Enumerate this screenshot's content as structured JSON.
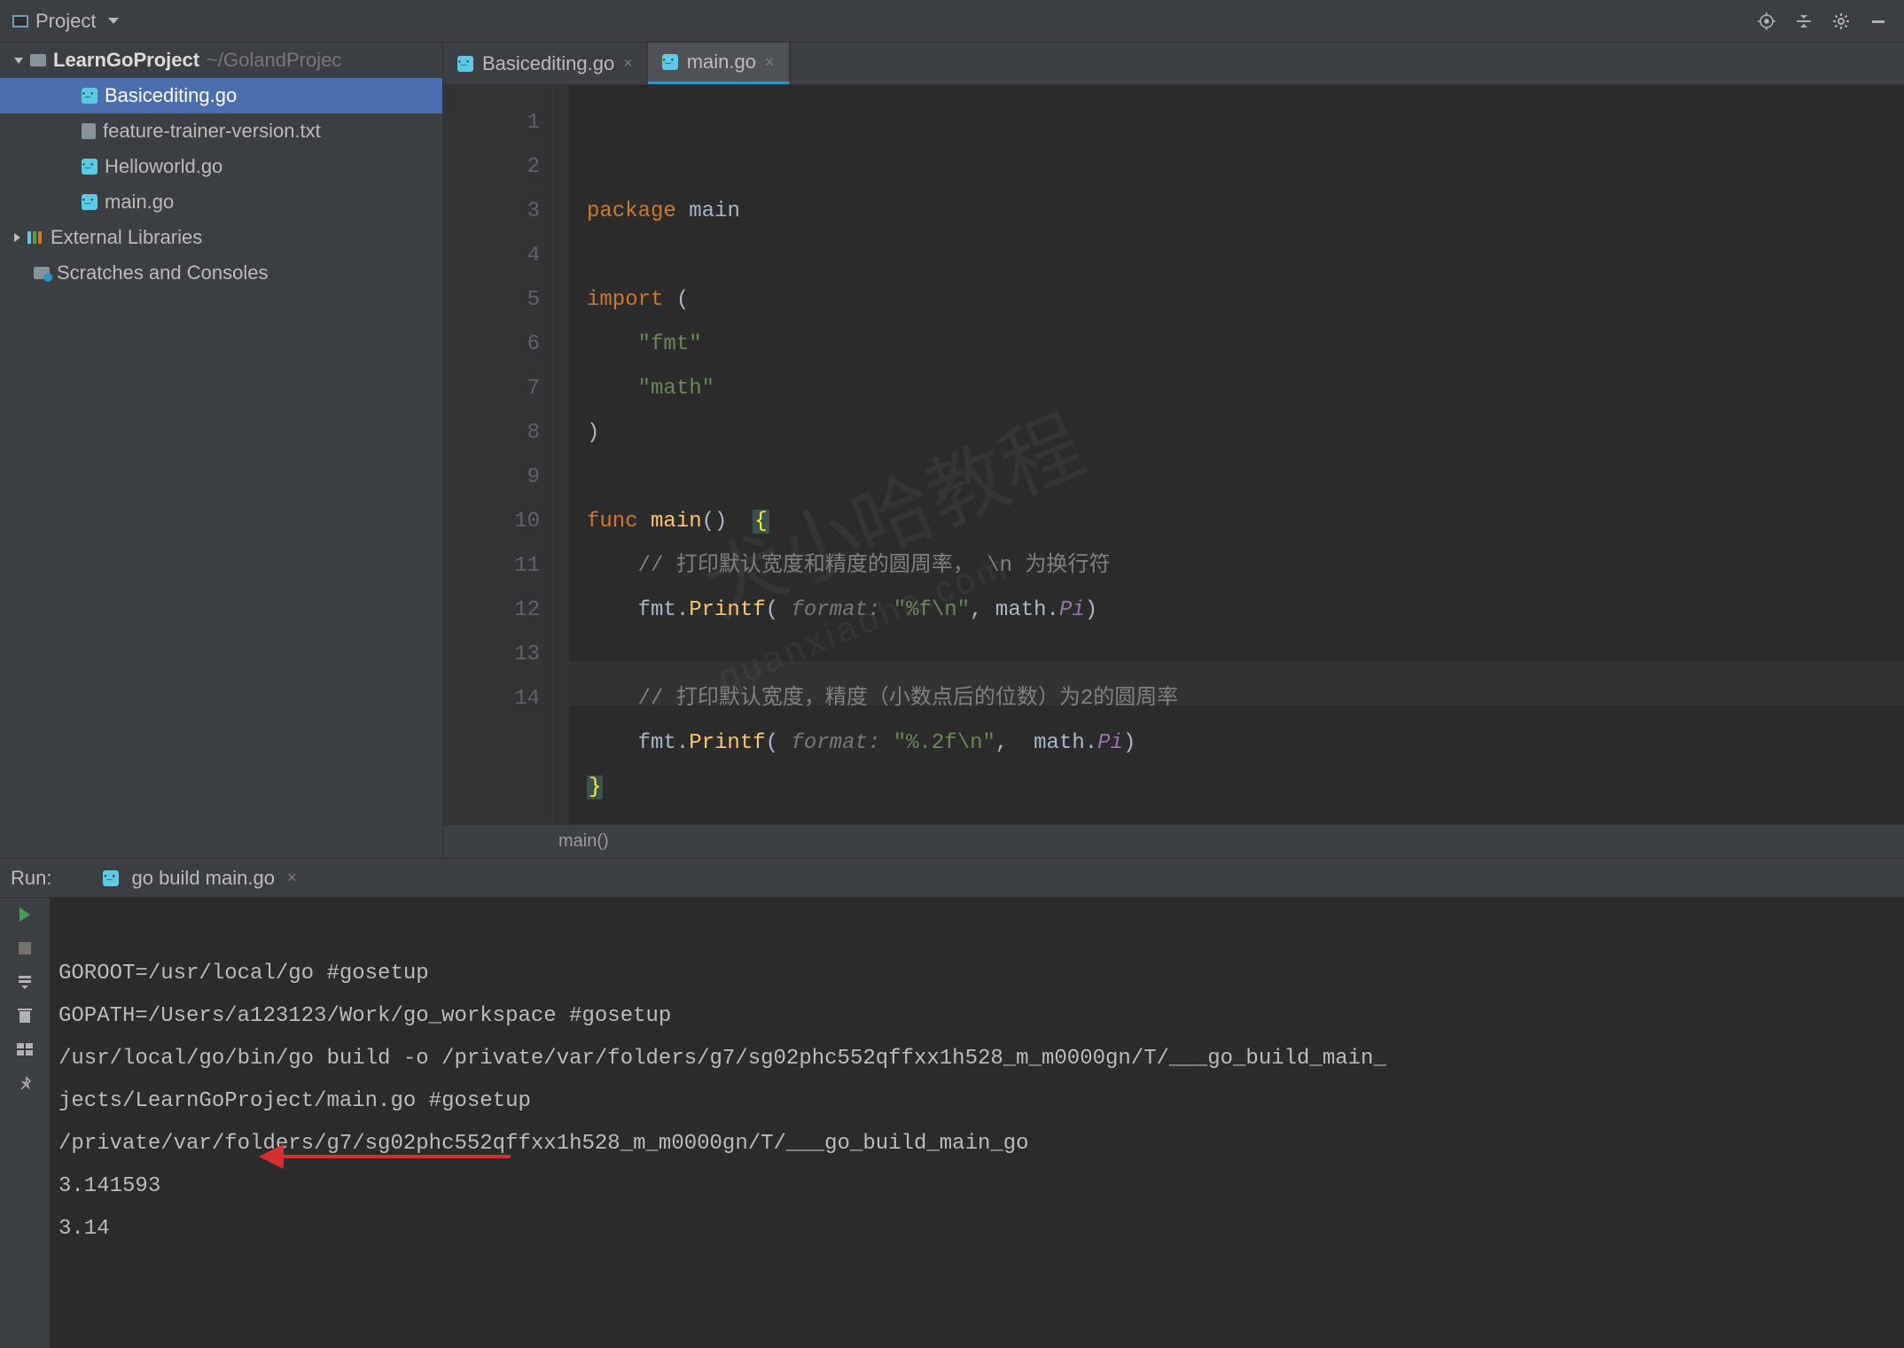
{
  "top": {
    "project_label": "Project"
  },
  "tree": {
    "root_name": "LearnGoProject",
    "root_path": "~/GolandProjec",
    "files": [
      "Basicediting.go",
      "feature-trainer-version.txt",
      "Helloworld.go",
      "main.go"
    ],
    "external": "External Libraries",
    "scratches": "Scratches and Consoles"
  },
  "tabs": [
    {
      "label": "Basicediting.go",
      "active": false
    },
    {
      "label": "main.go",
      "active": true
    }
  ],
  "editor": {
    "lines": [
      "1",
      "2",
      "3",
      "4",
      "5",
      "6",
      "7",
      "8",
      "9",
      "10",
      "11",
      "12",
      "13",
      "14"
    ],
    "code": {
      "l1_kw": "package",
      "l1_id": "main",
      "l3_kw": "import",
      "l3_p": "(",
      "l4_str": "\"fmt\"",
      "l5_str": "\"math\"",
      "l6_p": ")",
      "l8_kw": "func",
      "l8_fn": "main",
      "l8_pp": "()",
      "l8_ob": "{",
      "l9_cm": "// 打印默认宽度和精度的圆周率， \\n 为换行符",
      "l10_a": "fmt.",
      "l10_fn": "Printf",
      "l10_op": "( ",
      "l10_hint": "format:",
      "l10_str": "\"%f\\n\"",
      "l10_c": ", math.",
      "l10_id": "Pi",
      "l10_cp": ")",
      "l12_cm": "// 打印默认宽度，精度（小数点后的位数）为2的圆周率",
      "l13_a": "fmt.",
      "l13_fn": "Printf",
      "l13_op": "( ",
      "l13_hint": "format:",
      "l13_str": "\"%.2f\\n\"",
      "l13_c": ",  math.",
      "l13_id": "Pi",
      "l13_cp": ")",
      "l14_cb": "}"
    },
    "breadcrumb": "main()"
  },
  "run": {
    "label": "Run:",
    "config": "go build main.go",
    "output": [
      "GOROOT=/usr/local/go #gosetup",
      "GOPATH=/Users/a123123/Work/go_workspace #gosetup",
      "/usr/local/go/bin/go build -o /private/var/folders/g7/sg02phc552qffxx1h528_m_m0000gn/T/___go_build_main_",
      "jects/LearnGoProject/main.go #gosetup",
      "/private/var/folders/g7/sg02phc552qffxx1h528_m_m0000gn/T/___go_build_main_go",
      "3.141593",
      "3.14"
    ]
  },
  "watermark": {
    "big": "犬小哈教程",
    "small": "quanxiaoha.com"
  }
}
